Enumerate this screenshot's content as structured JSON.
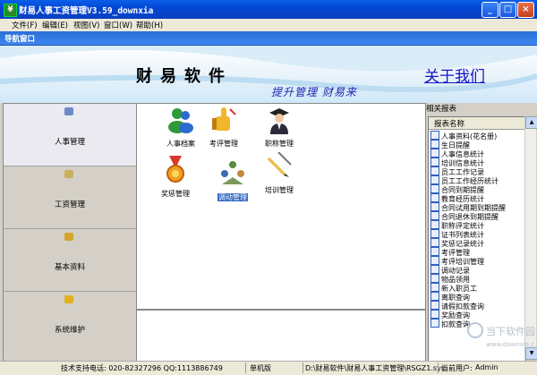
{
  "window": {
    "title": "财易人事工资管理V3.59_downxia",
    "buttons": [
      "_",
      "□",
      "×"
    ]
  },
  "menu": [
    "文件(F)",
    "编辑(E)",
    "视图(V)",
    "窗口(W)",
    "帮助(H)"
  ],
  "nav_header": "导航窗口",
  "banner": {
    "brand": "财易软件",
    "slogan": "提升管理 财易来",
    "about_link": "关于我们"
  },
  "left_nav": [
    {
      "label": "人事管理",
      "icon": "people-icon",
      "active": true
    },
    {
      "label": "工资管理",
      "icon": "coins-icon",
      "active": false
    },
    {
      "label": "基本资料",
      "icon": "book-icon",
      "active": false
    },
    {
      "label": "系统维护",
      "icon": "key-icon",
      "active": false
    }
  ],
  "modules": [
    {
      "label": "人事档案",
      "icon": "users-icon",
      "selected": false
    },
    {
      "label": "考评管理",
      "icon": "thumbs-up-icon",
      "selected": false
    },
    {
      "label": "职称管理",
      "icon": "graduate-icon",
      "selected": false
    },
    {
      "label": "奖惩管理",
      "icon": "medal-icon",
      "selected": false
    },
    {
      "label": "调动管理",
      "icon": "transfer-icon",
      "selected": true
    },
    {
      "label": "培训管理",
      "icon": "pen-icon",
      "selected": false
    }
  ],
  "reports": {
    "title": "相关报表",
    "column": "报表名称",
    "items": [
      "人事资料(花名册)",
      "生日提醒",
      "人事信息统计",
      "培训信息统计",
      "员工工作记录",
      "员工工作经历统计",
      "合同到期提醒",
      "教育经历统计",
      "合同试用期到期提醒",
      "合同退休到期提醒",
      "职称评定统计",
      "证书列表统计",
      "奖惩记录统计",
      "考评管理",
      "考评培训管理",
      "调动记录",
      "物品领用",
      "新入职员工",
      "离职查询",
      "请假扣款查询",
      "奖励查询",
      "扣款查询"
    ]
  },
  "status": {
    "support": "技术支持电话: 020-82327296 QQ:1113886749",
    "mode": "单机版",
    "path": "D:\\财易软件\\财易人事工资管理\\RSGZ1.sys",
    "user_label": "当前用户:",
    "user": "Admin"
  },
  "watermark": {
    "text": "当下软件园",
    "url": "www.downxia.com"
  },
  "colors": {
    "titlebar": "#0347d6",
    "nav_header": "#3d86ee",
    "link": "#1414c8",
    "slogan": "#1f1fb2",
    "selection": "#316ac5"
  }
}
